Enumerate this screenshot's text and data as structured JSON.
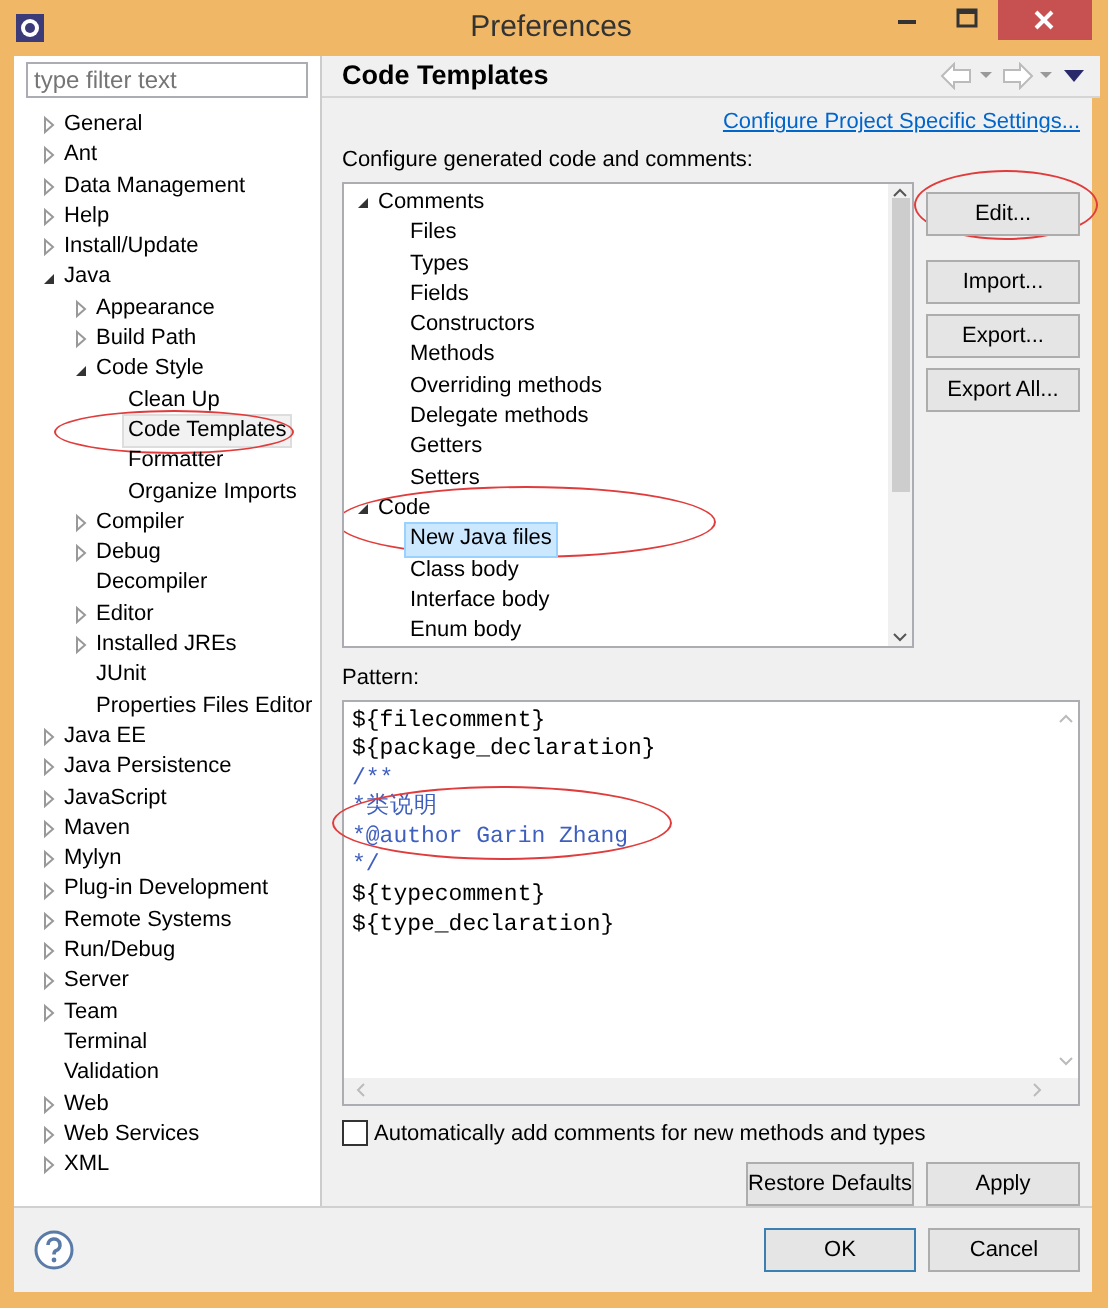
{
  "window": {
    "title": "Preferences"
  },
  "sidebar": {
    "filter": {
      "placeholder": "type filter text"
    },
    "items": [
      {
        "label": "General",
        "kind": "group",
        "expanded": false,
        "selected": false
      },
      {
        "label": "Ant",
        "kind": "group",
        "expanded": false,
        "selected": false
      },
      {
        "label": "Data Management",
        "kind": "group",
        "expanded": false,
        "selected": false
      },
      {
        "label": "Help",
        "kind": "group",
        "expanded": false,
        "selected": false
      },
      {
        "label": "Install/Update",
        "kind": "group",
        "expanded": false,
        "selected": false
      },
      {
        "label": "Java",
        "kind": "group",
        "expanded": true,
        "selected": false,
        "children": [
          {
            "label": "Appearance",
            "kind": "group",
            "expanded": false,
            "selected": false
          },
          {
            "label": "Build Path",
            "kind": "group",
            "expanded": false,
            "selected": false
          },
          {
            "label": "Code Style",
            "kind": "group",
            "expanded": true,
            "selected": false,
            "children": [
              {
                "label": "Clean Up",
                "kind": "leaf",
                "selected": false
              },
              {
                "label": "Code Templates",
                "kind": "leaf",
                "selected": true,
                "circled": true
              },
              {
                "label": "Formatter",
                "kind": "leaf",
                "selected": false
              },
              {
                "label": "Organize Imports",
                "kind": "leaf",
                "selected": false
              }
            ]
          },
          {
            "label": "Compiler",
            "kind": "group",
            "expanded": false,
            "selected": false
          },
          {
            "label": "Debug",
            "kind": "group",
            "expanded": false,
            "selected": false
          },
          {
            "label": "Decompiler",
            "kind": "leaf",
            "selected": false
          },
          {
            "label": "Editor",
            "kind": "group",
            "expanded": false,
            "selected": false
          },
          {
            "label": "Installed JREs",
            "kind": "group",
            "expanded": false,
            "selected": false
          },
          {
            "label": "JUnit",
            "kind": "leaf",
            "selected": false
          },
          {
            "label": "Properties Files Editor",
            "kind": "leaf",
            "selected": false
          }
        ]
      },
      {
        "label": "Java EE",
        "kind": "group",
        "expanded": false,
        "selected": false
      },
      {
        "label": "Java Persistence",
        "kind": "group",
        "expanded": false,
        "selected": false
      },
      {
        "label": "JavaScript",
        "kind": "group",
        "expanded": false,
        "selected": false
      },
      {
        "label": "Maven",
        "kind": "group",
        "expanded": false,
        "selected": false
      },
      {
        "label": "Mylyn",
        "kind": "group",
        "expanded": false,
        "selected": false
      },
      {
        "label": "Plug-in Development",
        "kind": "group",
        "expanded": false,
        "selected": false
      },
      {
        "label": "Remote Systems",
        "kind": "group",
        "expanded": false,
        "selected": false
      },
      {
        "label": "Run/Debug",
        "kind": "group",
        "expanded": false,
        "selected": false
      },
      {
        "label": "Server",
        "kind": "group",
        "expanded": false,
        "selected": false
      },
      {
        "label": "Team",
        "kind": "group",
        "expanded": false,
        "selected": false
      },
      {
        "label": "Terminal",
        "kind": "leaf",
        "selected": false
      },
      {
        "label": "Validation",
        "kind": "leaf",
        "selected": false
      },
      {
        "label": "Web",
        "kind": "group",
        "expanded": false,
        "selected": false
      },
      {
        "label": "Web Services",
        "kind": "group",
        "expanded": false,
        "selected": false
      },
      {
        "label": "XML",
        "kind": "group",
        "expanded": false,
        "selected": false
      }
    ]
  },
  "page": {
    "title": "Code Templates",
    "link": "Configure Project Specific Settings...",
    "tree_label": "Configure generated code and comments:",
    "tree": [
      {
        "label": "Comments",
        "kind": "group",
        "expanded": true,
        "selected": false,
        "children": [
          {
            "label": "Files",
            "kind": "leaf",
            "selected": false
          },
          {
            "label": "Types",
            "kind": "leaf",
            "selected": false
          },
          {
            "label": "Fields",
            "kind": "leaf",
            "selected": false
          },
          {
            "label": "Constructors",
            "kind": "leaf",
            "selected": false
          },
          {
            "label": "Methods",
            "kind": "leaf",
            "selected": false
          },
          {
            "label": "Overriding methods",
            "kind": "leaf",
            "selected": false
          },
          {
            "label": "Delegate methods",
            "kind": "leaf",
            "selected": false
          },
          {
            "label": "Getters",
            "kind": "leaf",
            "selected": false
          },
          {
            "label": "Setters",
            "kind": "leaf",
            "selected": false
          }
        ]
      },
      {
        "label": "Code",
        "kind": "group",
        "expanded": true,
        "selected": false,
        "circled": true,
        "children": [
          {
            "label": "New Java files",
            "kind": "leaf",
            "selected": true
          },
          {
            "label": "Class body",
            "kind": "leaf",
            "selected": false
          },
          {
            "label": "Interface body",
            "kind": "leaf",
            "selected": false
          },
          {
            "label": "Enum body",
            "kind": "leaf",
            "selected": false
          }
        ]
      }
    ],
    "side_buttons": [
      {
        "label": "Edit...",
        "circled": true
      },
      {
        "label": "Import...",
        "circled": false
      },
      {
        "label": "Export...",
        "circled": false
      },
      {
        "label": "Export All...",
        "circled": false
      }
    ],
    "pattern_label": "Pattern:",
    "pattern": [
      {
        "text": "${filecomment}",
        "kind": "code",
        "circled": false
      },
      {
        "text": "${package_declaration}",
        "kind": "code",
        "circled": false
      },
      {
        "text": "/**",
        "kind": "comment",
        "circled": false
      },
      {
        "text": "*类说明",
        "kind": "comment",
        "circled": true
      },
      {
        "text": "*@author Garin Zhang",
        "kind": "comment",
        "circled": true
      },
      {
        "text": "*/",
        "kind": "comment",
        "circled": false
      },
      {
        "text": "${typecomment}",
        "kind": "code",
        "circled": false
      },
      {
        "text": "${type_declaration}",
        "kind": "code",
        "circled": false
      }
    ],
    "auto_comments": {
      "label": "Automatically add comments for new methods and types",
      "checked": false
    },
    "buttons": [
      "Restore Defaults",
      "Apply"
    ]
  },
  "footer": {
    "buttons": [
      "OK",
      "Cancel"
    ]
  }
}
